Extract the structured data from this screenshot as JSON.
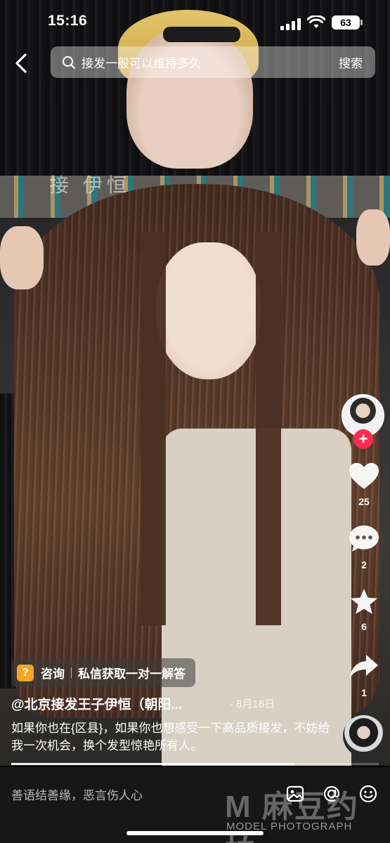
{
  "status_bar": {
    "time": "15:16",
    "battery": "63"
  },
  "search": {
    "query": "接发一般可以维持多久",
    "button_label": "搜索"
  },
  "watermark_top": "接 伊恒",
  "rail": {
    "follow_label": "+",
    "likes": "25",
    "comments": "2",
    "favorites": "6",
    "shares": "1"
  },
  "caption": {
    "consult_icon": "?",
    "consult_label": "咨询",
    "consult_text": "私信获取一对一解答",
    "author": "@北京接发王子伊恒（朝阳...",
    "date": "· 8月18日",
    "description": "如果你也在{区县}，如果你也想感受一下高品质接发，不妨给我一次机会，换个发型惊艳所有人。"
  },
  "progress": {
    "fraction": 0.77
  },
  "comment_bar": {
    "placeholder": "善语结善缘，恶言伤人心"
  },
  "watermark_bottom": {
    "big": "M 麻豆约拍",
    "small": "MODEL PHOTOGRAPH"
  },
  "colors": {
    "follow": "#fe2c55",
    "consult_icon": "#f5a623",
    "comment_bar_bg": "#161616"
  },
  "icons": [
    "back-icon",
    "search-icon",
    "heart-icon",
    "comment-icon",
    "star-icon",
    "share-icon",
    "image-icon",
    "at-icon",
    "emoji-icon"
  ]
}
